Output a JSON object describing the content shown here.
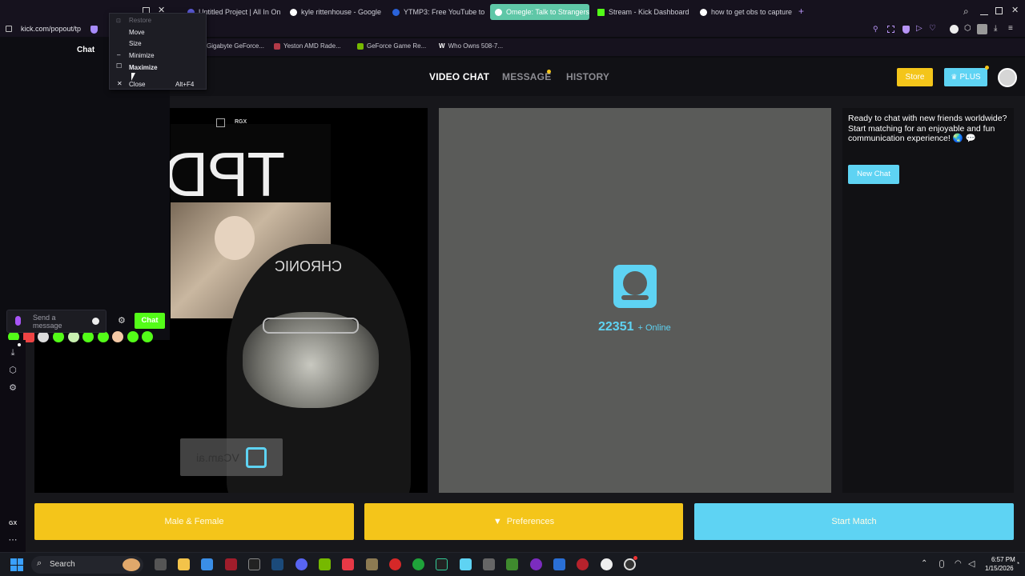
{
  "browser": {
    "tabs": [
      {
        "label": "Untitled Project | All In One",
        "color": "#5a5ad6"
      },
      {
        "label": "kyle rittenhouse - Google",
        "color": "#ffffff"
      },
      {
        "label": "YTMP3: Free YouTube to M",
        "color": "#2a62d9"
      },
      {
        "label": "Omegle: Talk to Strangers",
        "color": "#5fc7a7"
      },
      {
        "label": "Stream - Kick Dashboard",
        "color": "#53fc18"
      },
      {
        "label": "how to get obs to capture",
        "color": "#ffffff"
      }
    ],
    "new_tab": "+",
    "url": "kick.com/popout/tp",
    "bookmarks": [
      {
        "label": "Gigabyte GeForce...",
        "color": "#cccccc"
      },
      {
        "label": "Yeston AMD Rade...",
        "color": "#b23a48"
      },
      {
        "label": "GeForce Game Re...",
        "color": "#76b900"
      },
      {
        "label": "Who Owns 508-7...",
        "color": "#ffffff"
      }
    ]
  },
  "context_menu": {
    "items": [
      {
        "label": "Restore",
        "shortcut": "",
        "glyph": "⊡",
        "disabled": true
      },
      {
        "label": "Move",
        "shortcut": "",
        "glyph": "",
        "disabled": false
      },
      {
        "label": "Size",
        "shortcut": "",
        "glyph": "",
        "disabled": false
      },
      {
        "label": "Minimize",
        "shortcut": "",
        "glyph": "–",
        "disabled": false
      },
      {
        "label": "Maximize",
        "shortcut": "",
        "glyph": "☐",
        "disabled": false
      },
      {
        "label": "Close",
        "shortcut": "Alt+F4",
        "glyph": "✕",
        "disabled": false
      }
    ]
  },
  "kick_chat": {
    "title": "Chat",
    "message_placeholder": "Send a message",
    "chat_button": "Chat",
    "rail_label": "GX"
  },
  "site": {
    "nav": {
      "video_chat": "VIDEO CHAT",
      "message": "MESSAGE",
      "history": "HISTORY"
    },
    "store_button": "Store",
    "plus_button": "PLUS",
    "camera_tags": {
      "rgx": "RGX",
      "watermark": "VCam.ai",
      "letters": "TPD"
    },
    "online_count": "22351",
    "online_label": "+ Online",
    "welcome_text": "Ready to chat with new friends worldwide? Start matching for an enjoyable and fun communication experience! 🌏 💬",
    "new_chat_button": "New Chat",
    "gender_button": "Male & Female",
    "preferences_button": "Preferences",
    "start_button": "Start Match",
    "colors": {
      "yellow": "#f4c51a",
      "cyan": "#5ed3f3"
    }
  },
  "taskbar": {
    "search": "Search",
    "time": "6:57 PM",
    "date": "1/15/2026"
  }
}
